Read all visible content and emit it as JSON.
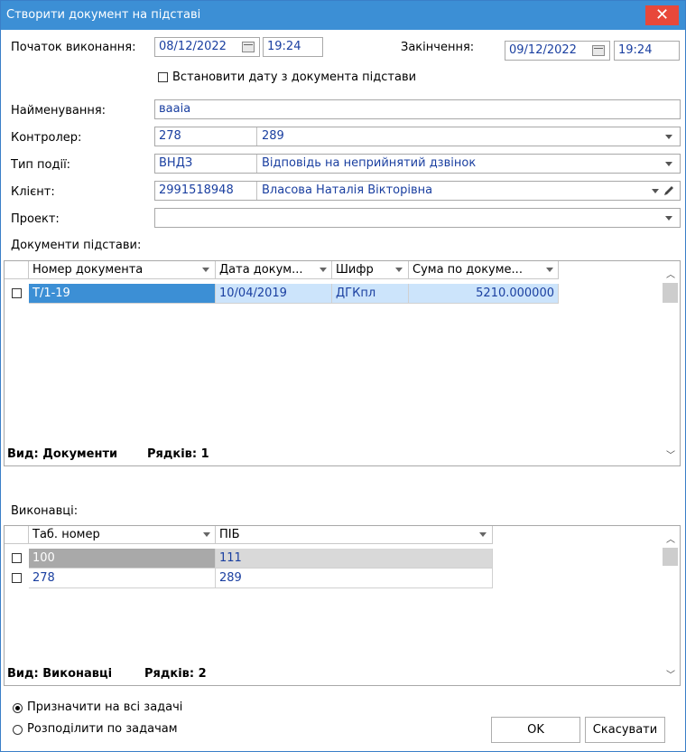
{
  "window": {
    "title": "Створити документ на підставі",
    "close_glyph": "✕"
  },
  "schedule": {
    "start_label": "Початок виконання:",
    "start_date": "08/12/2022",
    "start_time": "19:24",
    "end_label": "Закінчення:",
    "end_date": "09/12/2022",
    "end_time": "19:24",
    "set_date_checkbox_label": "Встановити дату з документа підстави"
  },
  "form": {
    "name_label": "Найменування:",
    "name_value": "вааіа",
    "controller_label": "Контролер:",
    "controller_code": "278",
    "controller_name": "289",
    "event_type_label": "Тип події:",
    "event_type_code": "ВНДЗ",
    "event_type_name": "Відповідь на  неприйнятий дзвінок",
    "client_label": "Клієнт:",
    "client_code": "2991518948",
    "client_name": "Власова Наталія Вікторівна",
    "project_label": "Проект:",
    "project_value": ""
  },
  "documents": {
    "section_label": "Документи підстави:",
    "columns": [
      "Номер документа",
      "Дата докум...",
      "Шифр",
      "Сума по докуме..."
    ],
    "rows": [
      {
        "number": "Т/1-19",
        "date": "10/04/2019",
        "code": "ДГКпл",
        "amount": "5210.000000"
      }
    ],
    "footer_view": "Вид: Документи",
    "footer_rows": "Рядків: 1"
  },
  "executors": {
    "section_label": "Виконавці:",
    "columns": [
      "Таб. номер",
      "ПІБ"
    ],
    "rows": [
      {
        "tab": "100",
        "name": "111"
      },
      {
        "tab": "278",
        "name": "289"
      }
    ],
    "footer_view": "Вид: Виконавці",
    "footer_rows": "Рядків: 2"
  },
  "assign": {
    "all_tasks_label": "Призначити на всі задачі",
    "distribute_label": "Розподілити по задачам",
    "selected": "all_tasks"
  },
  "buttons": {
    "ok": "OK",
    "cancel": "Скасувати"
  },
  "colors": {
    "titlebar": "#3c8fd5",
    "close": "#e8483a",
    "selected_row": "#cce4fb",
    "link_text": "#1a3fa0"
  }
}
